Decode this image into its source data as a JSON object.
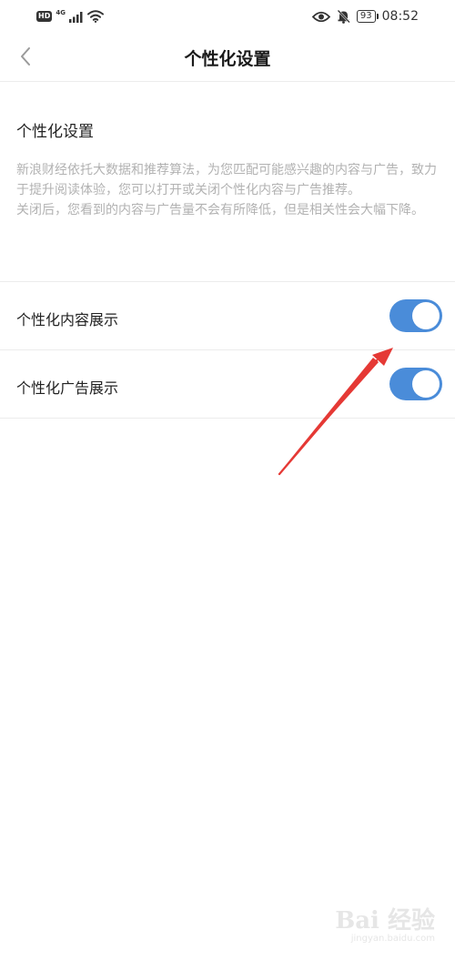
{
  "status_bar": {
    "hd_label": "HD",
    "network_label": "4G",
    "battery": "93",
    "time": "08:52"
  },
  "header": {
    "title": "个性化设置"
  },
  "intro": {
    "title": "个性化设置",
    "description": "新浪财经依托大数据和推荐算法，为您匹配可能感兴趣的内容与广告，致力于提升阅读体验，您可以打开或关闭个性化内容与广告推荐。\n关闭后，您看到的内容与广告量不会有所降低，但是相关性会大幅下降。"
  },
  "settings": [
    {
      "label": "个性化内容展示",
      "enabled": true
    },
    {
      "label": "个性化广告展示",
      "enabled": true
    }
  ],
  "colors": {
    "toggle_on": "#4a8cd9",
    "arrow": "#e53935",
    "description_text": "#b2b2b2"
  },
  "icons": {
    "back": "chevron-left-icon",
    "eye": "eye-icon",
    "bell_off": "bell-off-icon",
    "signal": "signal-icon",
    "wifi": "wifi-icon"
  },
  "watermark": {
    "main": "Bai 经验",
    "sub": "jingyan.baidu.com"
  }
}
